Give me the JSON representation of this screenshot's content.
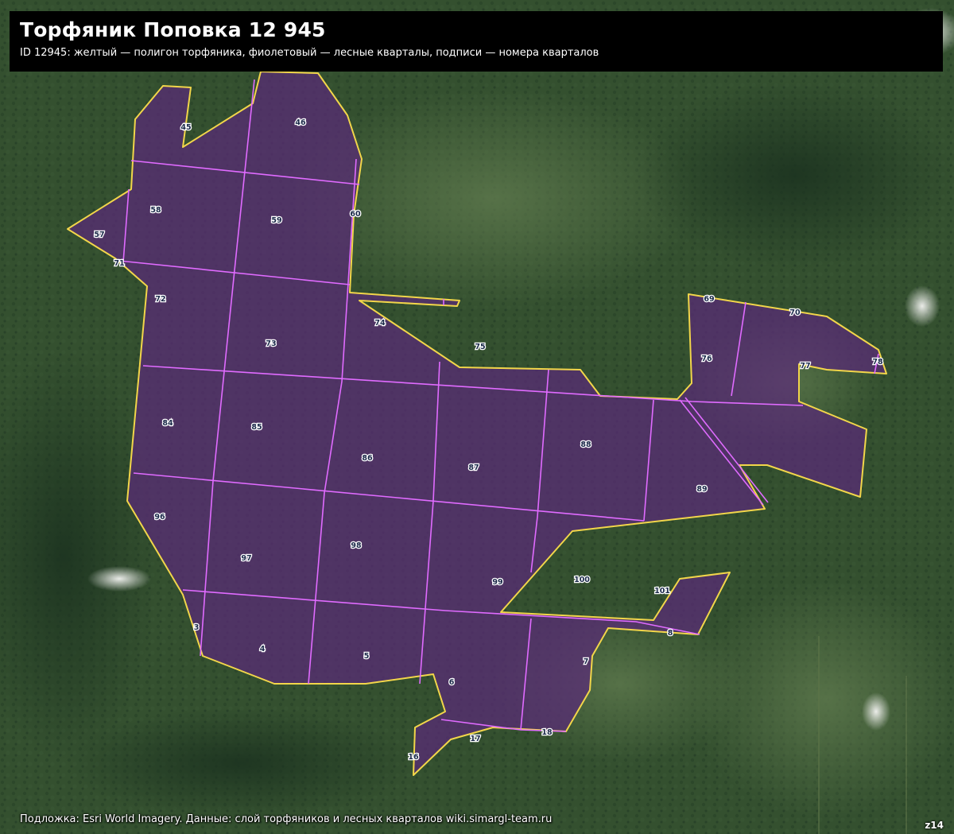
{
  "header": {
    "title": "Торфяник Поповка 12 945",
    "subtitle": "ID 12945: желтый — полигон торфяника, фиолетовый — лесные кварталы, подписи — номера кварталов"
  },
  "footer": {
    "attribution": "Подложка: Esri World Imagery. Данные: слой торфяников и лесных кварталов wiki.simargl-team.ru",
    "zoom": "z14"
  },
  "colors": {
    "peat_outline": "#f2d64a",
    "quarter_lines": "#e06bff",
    "peat_fill": "#5a2a78",
    "label_text": "#1b2a4a"
  },
  "map": {
    "quarters": [
      {
        "id": "45",
        "label": "45"
      },
      {
        "id": "46",
        "label": "46"
      },
      {
        "id": "57",
        "label": "57"
      },
      {
        "id": "58",
        "label": "58"
      },
      {
        "id": "59",
        "label": "59"
      },
      {
        "id": "60",
        "label": "60"
      },
      {
        "id": "71",
        "label": "71"
      },
      {
        "id": "72",
        "label": "72"
      },
      {
        "id": "73",
        "label": "73"
      },
      {
        "id": "74",
        "label": "74"
      },
      {
        "id": "75",
        "label": "75"
      },
      {
        "id": "69",
        "label": "69"
      },
      {
        "id": "70",
        "label": "70"
      },
      {
        "id": "76",
        "label": "76"
      },
      {
        "id": "77",
        "label": "77"
      },
      {
        "id": "78",
        "label": "78"
      },
      {
        "id": "84",
        "label": "84"
      },
      {
        "id": "85",
        "label": "85"
      },
      {
        "id": "86",
        "label": "86"
      },
      {
        "id": "87",
        "label": "87"
      },
      {
        "id": "88",
        "label": "88"
      },
      {
        "id": "89",
        "label": "89"
      },
      {
        "id": "96",
        "label": "96"
      },
      {
        "id": "97",
        "label": "97"
      },
      {
        "id": "98",
        "label": "98"
      },
      {
        "id": "99",
        "label": "99"
      },
      {
        "id": "100",
        "label": "100"
      },
      {
        "id": "101",
        "label": "101"
      },
      {
        "id": "3",
        "label": "3"
      },
      {
        "id": "4",
        "label": "4"
      },
      {
        "id": "5",
        "label": "5"
      },
      {
        "id": "6",
        "label": "6"
      },
      {
        "id": "7",
        "label": "7"
      },
      {
        "id": "8",
        "label": "8"
      },
      {
        "id": "16",
        "label": "16"
      },
      {
        "id": "17",
        "label": "17"
      },
      {
        "id": "18",
        "label": "18"
      }
    ]
  }
}
